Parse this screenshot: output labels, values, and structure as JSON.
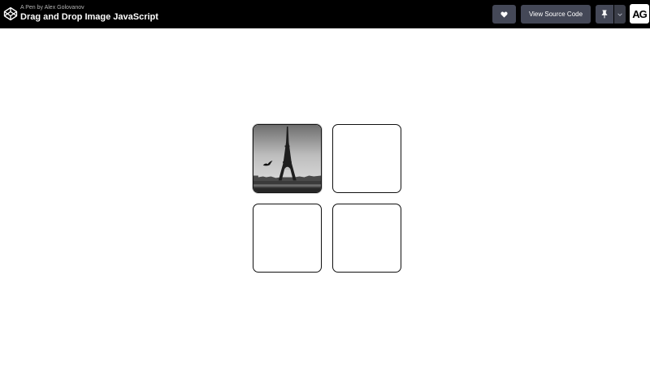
{
  "header": {
    "pen_by": "A Pen by Alex Golovanov",
    "title": "Drag and Drop Image JavaScript",
    "view_source_label": "View Source Code",
    "avatar_text": "AG",
    "icons": {
      "logo": "codepen-logo-icon",
      "heart": "heart-icon",
      "pin": "pin-icon",
      "menu": "chevron-down-icon"
    }
  },
  "board": {
    "slots": [
      {
        "label": "slot-1",
        "content": "eiffel-tower-photo"
      },
      {
        "label": "slot-2",
        "content": ""
      },
      {
        "label": "slot-3",
        "content": ""
      },
      {
        "label": "slot-4",
        "content": ""
      }
    ]
  },
  "colors": {
    "header_bg": "#000000",
    "button_bg": "#444857",
    "slot_border": "#111111",
    "page_bg": "#ffffff"
  }
}
